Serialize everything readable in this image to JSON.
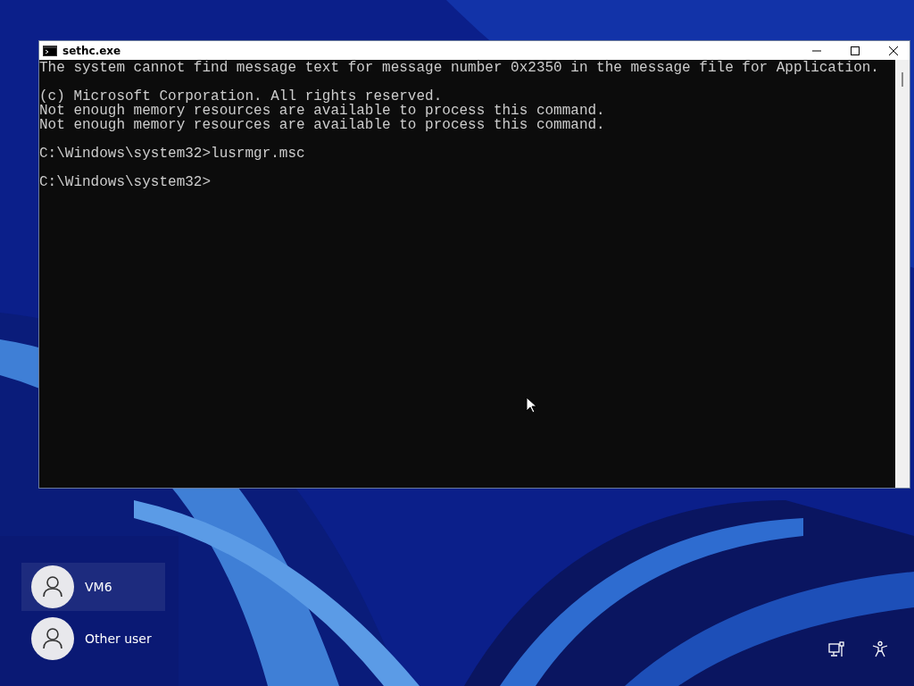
{
  "window": {
    "title": "sethc.exe"
  },
  "console": {
    "blocks": [
      [
        "The system cannot find message text for message number 0x2350 in the message file for Application."
      ],
      [
        "(c) Microsoft Corporation. All rights reserved.",
        "Not enough memory resources are available to process this command.",
        "Not enough memory resources are available to process this command."
      ],
      [
        "C:\\Windows\\system32>lusrmgr.msc"
      ],
      [
        "C:\\Windows\\system32>"
      ]
    ]
  },
  "users": [
    {
      "name": "VM6",
      "selected": true
    },
    {
      "name": "Other user",
      "selected": false
    }
  ]
}
